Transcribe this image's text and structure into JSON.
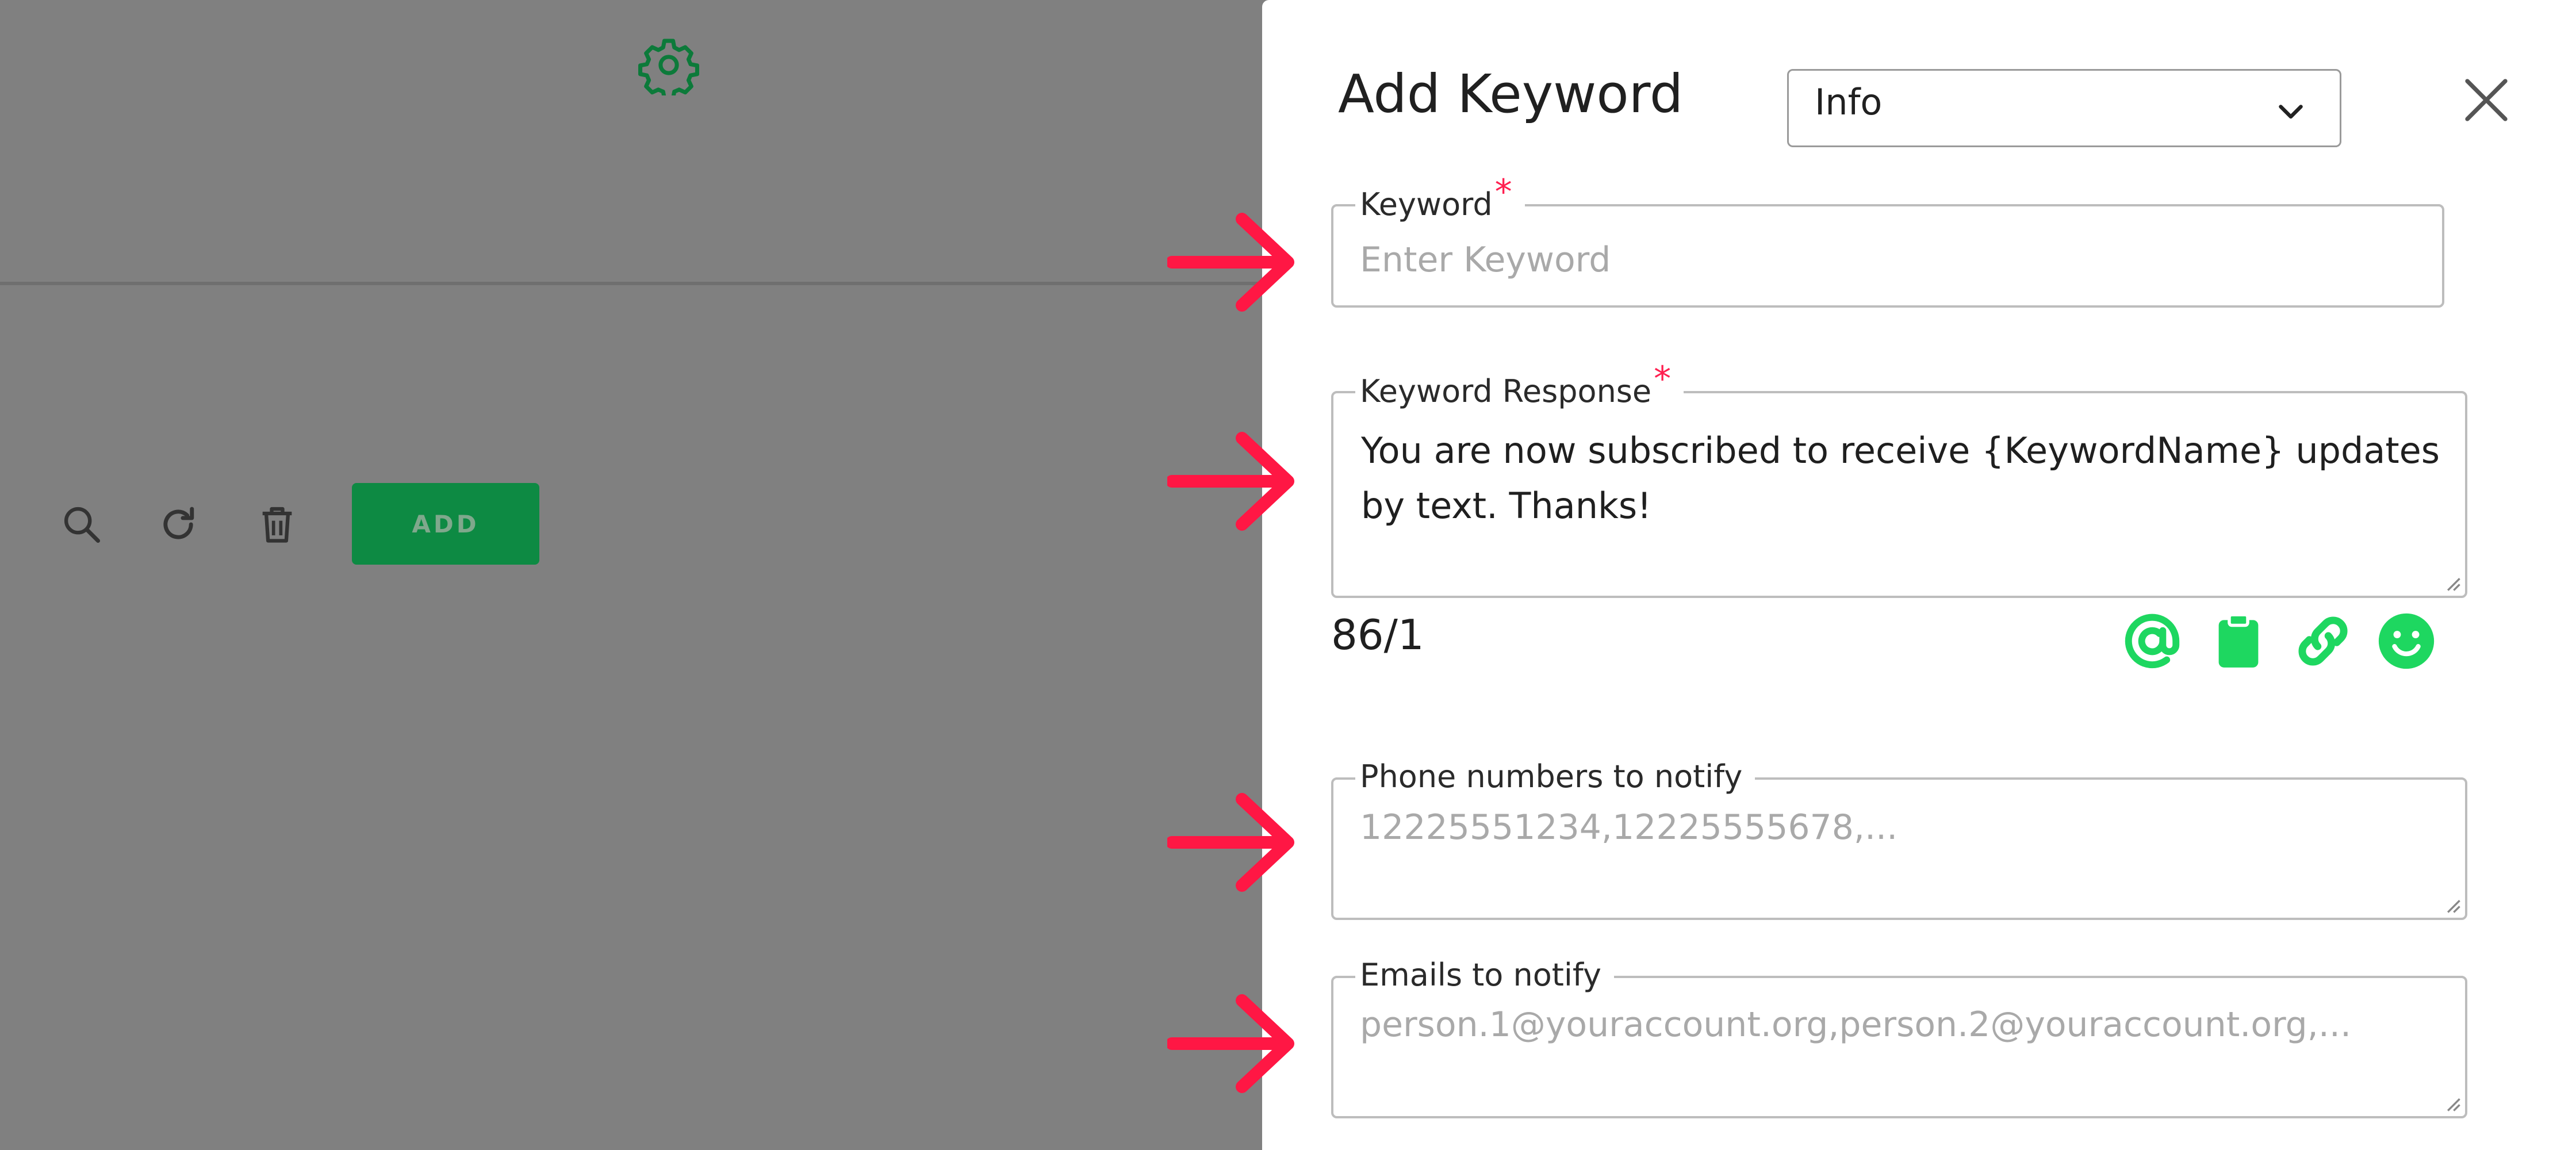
{
  "background": {
    "toolbar": {
      "settings_icon": "gear-icon",
      "search_icon": "search-icon",
      "refresh_icon": "refresh-icon",
      "delete_icon": "trash-icon",
      "add_label": "ADD"
    }
  },
  "drawer": {
    "title": "Add Keyword",
    "select": {
      "value": "Info"
    },
    "close_icon": "close-icon",
    "keyword": {
      "label": "Keyword",
      "required_mark": "*",
      "placeholder": "Enter Keyword",
      "value": ""
    },
    "keyword_response": {
      "label": "Keyword Response",
      "required_mark": "*",
      "value": "You are now subscribed to receive {KeywordName} updates by text. Thanks!"
    },
    "counter": "86/1",
    "insert_icons": [
      "at-icon",
      "clipboard-icon",
      "link-icon",
      "emoji-icon"
    ],
    "phone_numbers": {
      "label": "Phone numbers to notify",
      "placeholder": "12225551234,12225555678,..."
    },
    "emails": {
      "label": "Emails to notify",
      "placeholder": "person.1@youraccount.org,person.2@youraccount.org,..."
    }
  },
  "colors": {
    "accent_green": "#1ed760",
    "add_button_green": "#0d8a43",
    "annotation_arrow": "#ff1744",
    "required_mark": "#ff2050"
  }
}
